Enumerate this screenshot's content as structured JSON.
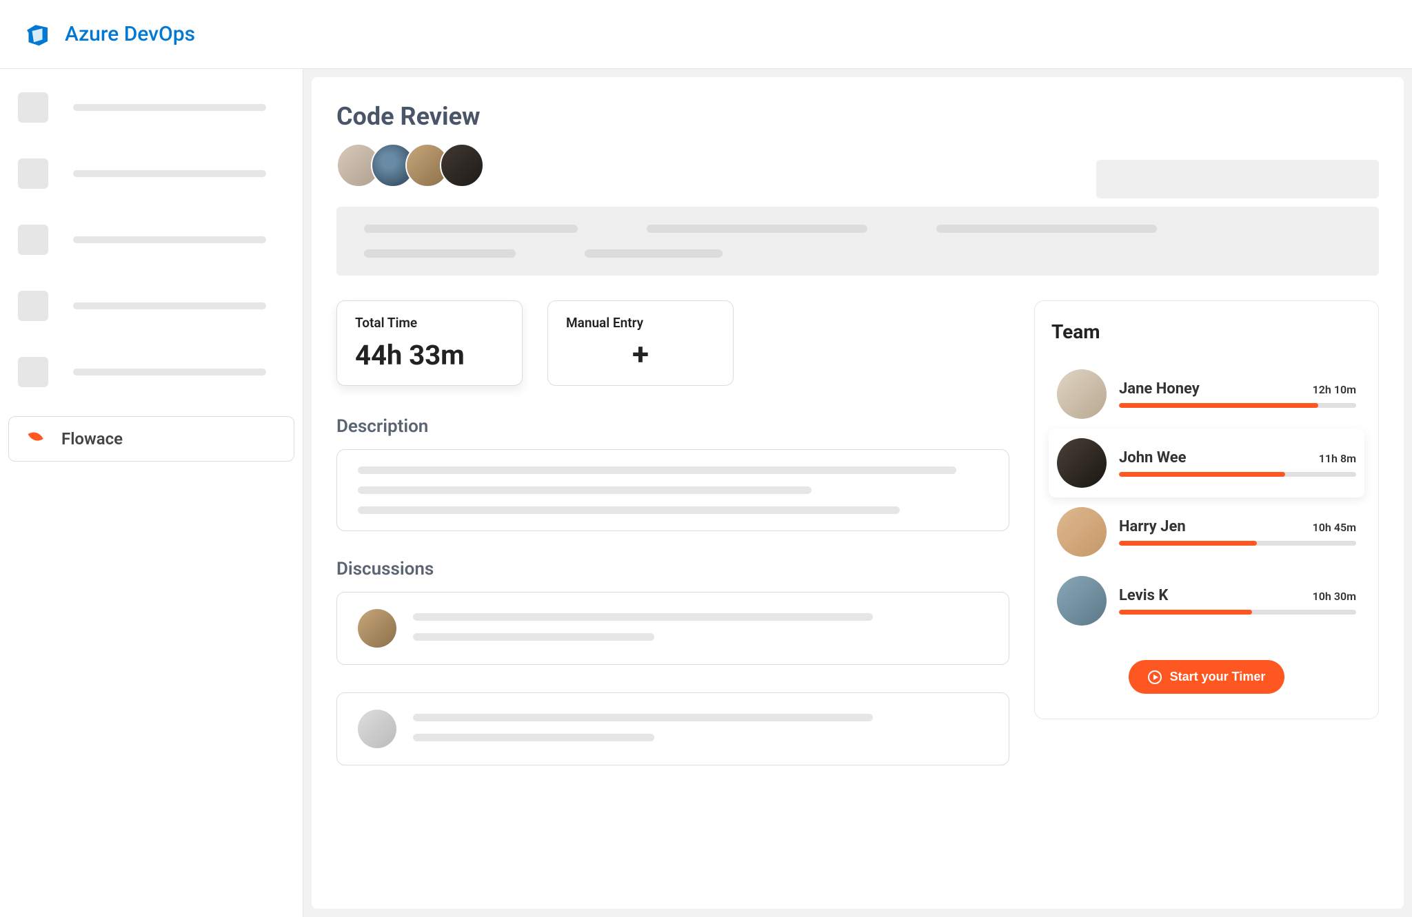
{
  "brand": "Azure DevOps",
  "sidebar": {
    "active_label": "Flowace"
  },
  "page": {
    "title": "Code Review",
    "total_time": {
      "label": "Total Time",
      "value": "44h 33m"
    },
    "manual_entry": {
      "label": "Manual Entry"
    },
    "description_heading": "Description",
    "discussions_heading": "Discussions"
  },
  "team": {
    "heading": "Team",
    "members": [
      {
        "name": "Jane Honey",
        "time": "12h 10m",
        "progress": 84
      },
      {
        "name": "John Wee",
        "time": "11h 8m",
        "progress": 70
      },
      {
        "name": "Harry Jen",
        "time": "10h 45m",
        "progress": 58
      },
      {
        "name": "Levis K",
        "time": "10h 30m",
        "progress": 56
      }
    ],
    "button": "Start your Timer"
  }
}
